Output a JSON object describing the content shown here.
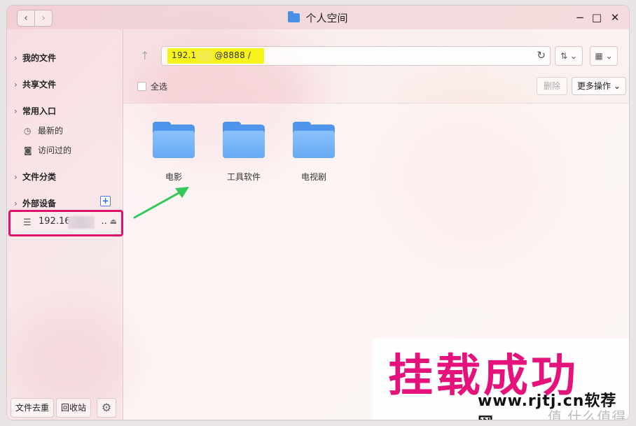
{
  "window": {
    "title": "个人空间",
    "nav_back": "‹",
    "nav_forward": "›",
    "minimize": "−",
    "maximize": "□",
    "close": "✕"
  },
  "sidebar": {
    "my_files": "我的文件",
    "shared_files": "共享文件",
    "common_entry": "常用入口",
    "recent": "最新的",
    "visited": "访问过的",
    "file_category": "文件分类",
    "external_devices": "外部设备",
    "add_device": "+",
    "device_name_prefix": "192.16",
    "device_name_suffix": "..",
    "bottom": {
      "dedupe": "文件去重",
      "recycle": "回收站"
    }
  },
  "toolbar": {
    "address_part1": "192.1",
    "address_part2": "@8888 /",
    "select_all": "全选",
    "delete": "删除",
    "more_actions": "更多操作",
    "sort_icon": "sort-icon",
    "grid_icon": "grid-view-icon"
  },
  "folders": [
    {
      "label": "电影"
    },
    {
      "label": "工具软件"
    },
    {
      "label": "电视剧"
    }
  ],
  "overlay": {
    "caption": "挂载成功",
    "watermark": "www.rjtj.cn软荐网",
    "watermark2": "值 什么值得买"
  },
  "colors": {
    "highlight_yellow": "#f6f31b",
    "accent_pink": "#e0136b",
    "arrow_green": "#34c759",
    "folder_blue": "#4f95ea"
  }
}
